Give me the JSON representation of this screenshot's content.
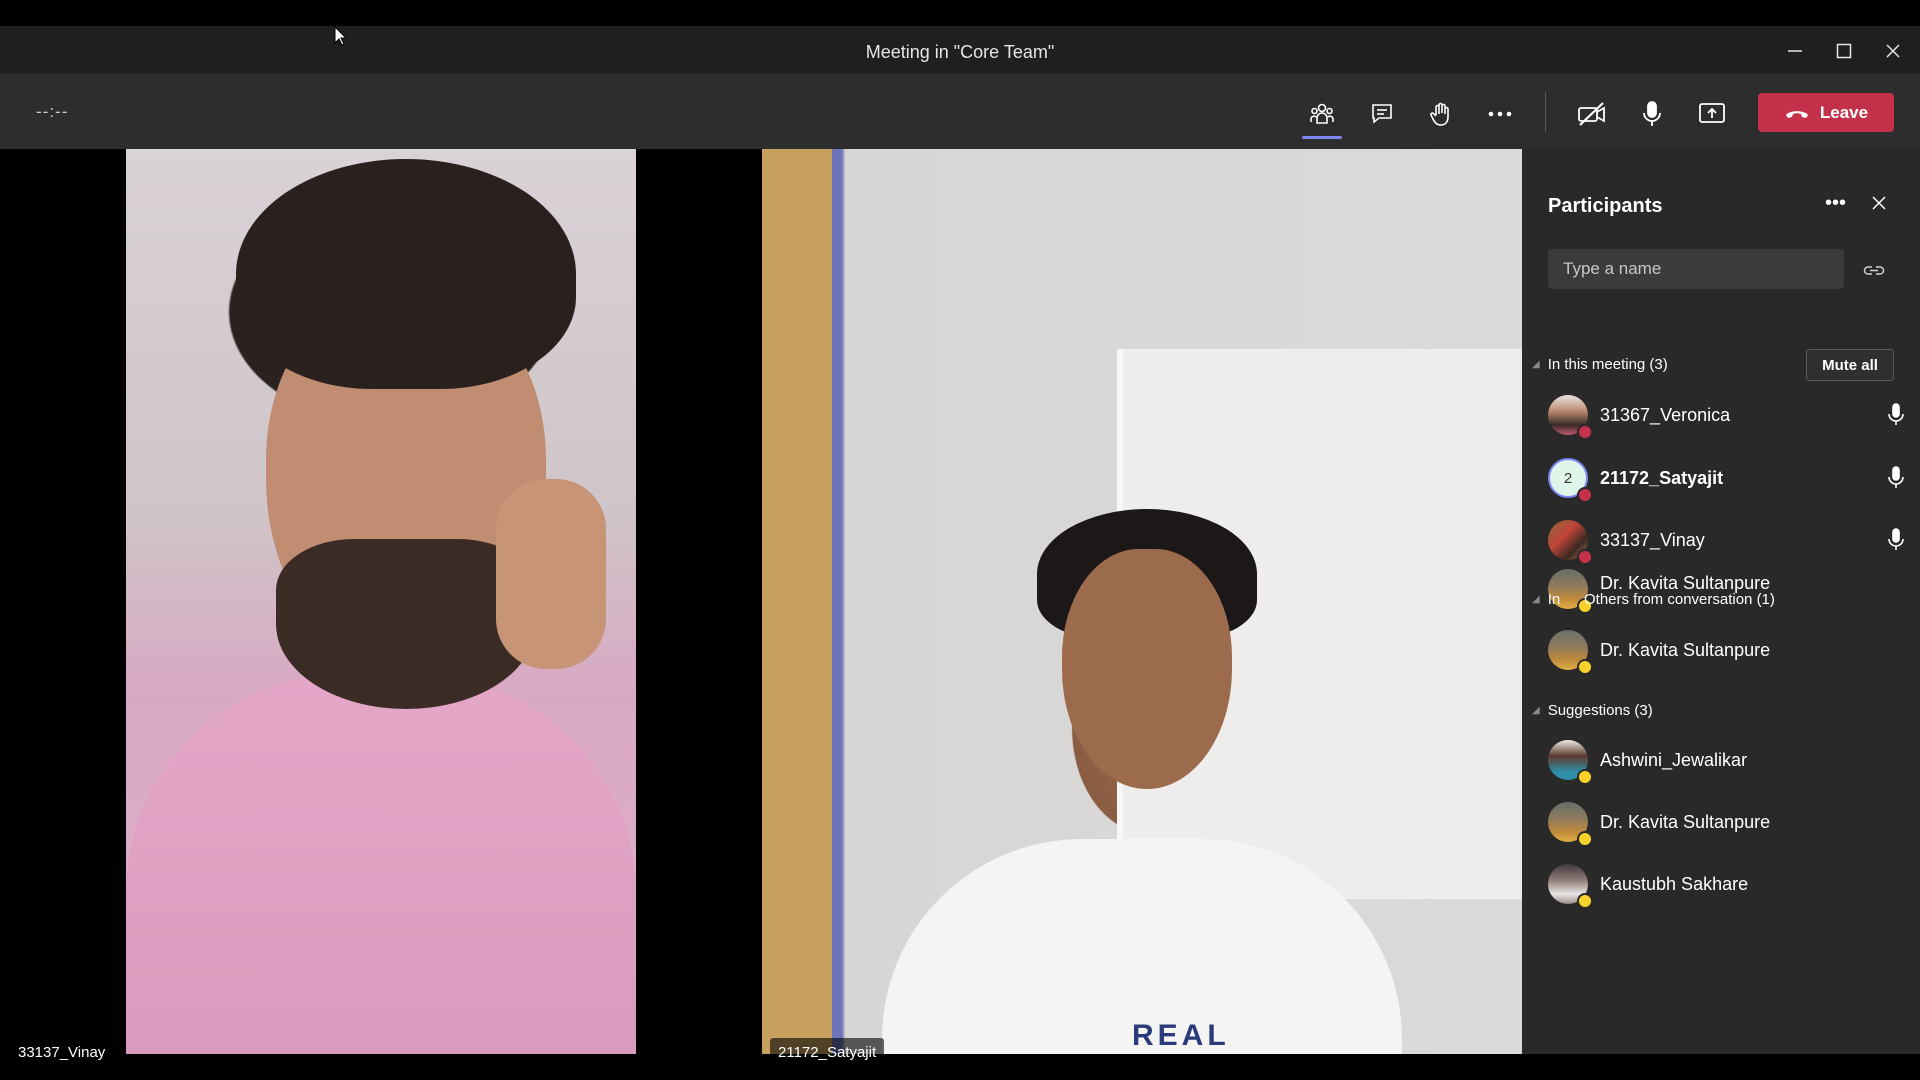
{
  "window": {
    "title": "Meeting in \"Core Team\"",
    "controls": [
      "minimize-icon",
      "maximize-icon",
      "close-icon"
    ]
  },
  "toolbar": {
    "timer": "--:--",
    "icons": [
      "participants-icon",
      "chat-icon",
      "raise-hand-icon",
      "more-icon",
      "camera-off-icon",
      "microphone-icon",
      "share-screen-icon"
    ],
    "leave_label": "Leave",
    "leave_color": "#c4314b"
  },
  "stage": {
    "tiles": [
      {
        "name": "33137_Vinay"
      },
      {
        "name": "21172_Satyajit"
      }
    ],
    "shirt_text": "REAL"
  },
  "participants_panel": {
    "title": "Participants",
    "search_placeholder": "Type a name",
    "in_meeting": {
      "label": "In this meeting (3)",
      "mute_all_label": "Mute all",
      "people": [
        {
          "name": "31367_Veronica",
          "status_color": "#c4314b",
          "mic": true
        },
        {
          "name": "21172_Satyajit",
          "avatar_text": "2",
          "status_color": "#c4314b",
          "mic": true,
          "bold": true
        },
        {
          "name": "33137_Vinay",
          "status_color": "#c4314b",
          "mic": true
        }
      ]
    },
    "overlap_name": "Dr. Kavita Sultanpure",
    "others": {
      "label": "Others from conversation (1)",
      "label_prefix": "In",
      "people": [
        {
          "name": "Dr. Kavita Sultanpure",
          "status_color": "#f8d22a"
        }
      ]
    },
    "suggestions": {
      "label": "Suggestions (3)",
      "people": [
        {
          "name": "Ashwini_Jewalikar",
          "status_color": "#f8d22a"
        },
        {
          "name": "Dr. Kavita Sultanpure",
          "status_color": "#f8d22a"
        },
        {
          "name": "Kaustubh Sakhare",
          "status_color": "#f8d22a"
        }
      ]
    }
  }
}
